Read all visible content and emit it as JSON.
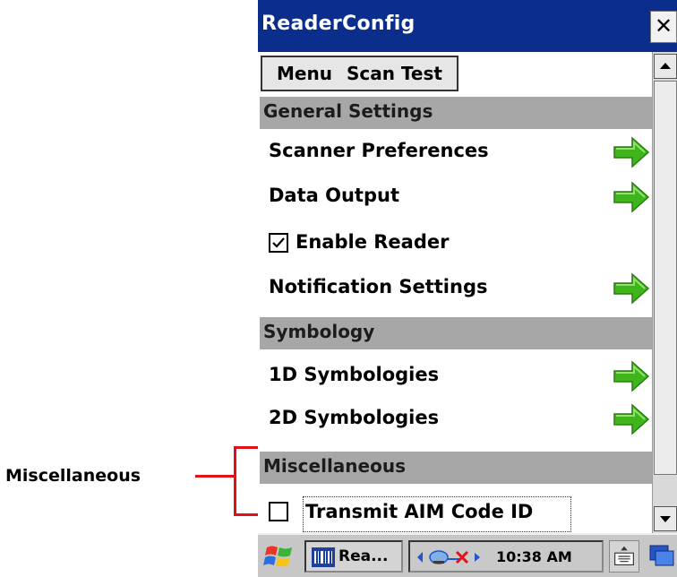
{
  "annotation": {
    "label": "Miscellaneous"
  },
  "window": {
    "title": "ReaderConfig",
    "close_label": "✕"
  },
  "menubar": {
    "items": [
      "Menu",
      "Scan Test"
    ]
  },
  "sections": {
    "general": "General Settings",
    "symbology": "Symbology",
    "misc": "Miscellaneous"
  },
  "items": {
    "scanner_preferences": "Scanner Preferences",
    "data_output": "Data Output",
    "enable_reader": {
      "label": "Enable Reader",
      "checked": true
    },
    "notification_settings": "Notification Settings",
    "symbologies_1d": "1D Symbologies",
    "symbologies_2d": "2D Symbologies",
    "transmit_aim": {
      "label": "Transmit AIM Code ID",
      "checked": false
    }
  },
  "taskbar": {
    "app_label": "Rea...",
    "clock": "10:38 AM"
  },
  "colors": {
    "titlebar": "#0b2e8c",
    "section_header": "#a7a7a7",
    "arrow_green": "#3fb51c",
    "callout": "#e3101a"
  }
}
